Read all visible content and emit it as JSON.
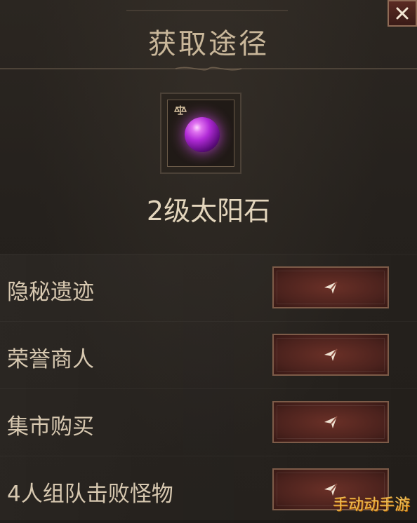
{
  "panel": {
    "title": "获取途径",
    "close_icon": "close-icon",
    "item": {
      "name": "2级太阳石",
      "icon": "purple-gem-icon",
      "badge_icon": "scales-icon"
    },
    "sources": [
      {
        "label": "隐秘遗迹",
        "action_icon": "navigate-arrow-icon"
      },
      {
        "label": "荣誉商人",
        "action_icon": "navigate-arrow-icon"
      },
      {
        "label": "集市购买",
        "action_icon": "navigate-arrow-icon"
      },
      {
        "label": "4人组队击败怪物",
        "action_icon": "navigate-arrow-icon"
      }
    ],
    "colors": {
      "title": "#c9b79a",
      "button": "#5a2a22",
      "gem": "#b02ad6",
      "watermark": "#f4c45a"
    }
  },
  "watermark": "手动动手游"
}
